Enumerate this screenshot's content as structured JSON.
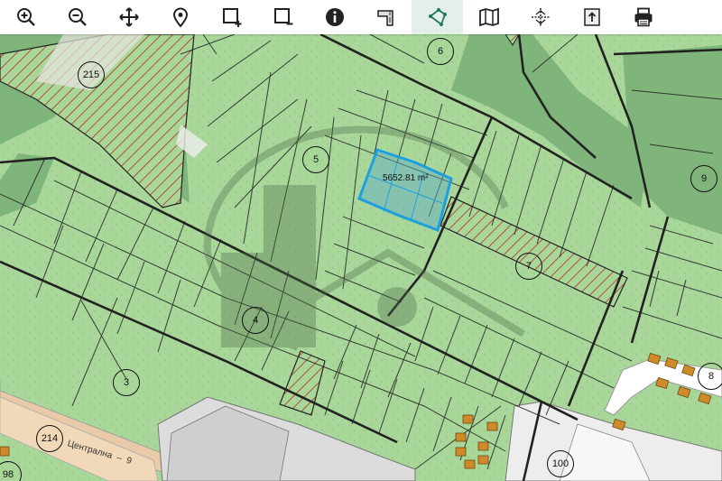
{
  "toolbar": {
    "tools": [
      {
        "name": "zoom-in",
        "icon": "zoom-in-icon"
      },
      {
        "name": "zoom-out",
        "icon": "zoom-out-icon"
      },
      {
        "name": "pan",
        "icon": "move-icon"
      },
      {
        "name": "locate",
        "icon": "map-pin-icon"
      },
      {
        "name": "select-add",
        "icon": "select-add-icon"
      },
      {
        "name": "select-remove",
        "icon": "select-remove-icon"
      },
      {
        "name": "info",
        "icon": "info-icon"
      },
      {
        "name": "measure-area",
        "icon": "measure-area-icon"
      },
      {
        "name": "polygon",
        "icon": "polygon-icon",
        "active": true
      },
      {
        "name": "layers",
        "icon": "map-icon"
      },
      {
        "name": "coordinates",
        "icon": "crosshair-icon"
      },
      {
        "name": "export",
        "icon": "export-icon"
      },
      {
        "name": "print",
        "icon": "printer-icon"
      }
    ]
  },
  "map": {
    "selected_area": "5652.81 m²",
    "road_name": "Централна",
    "road_number": "9",
    "parcel_numbers": [
      "215",
      "6",
      "5",
      "9",
      "7",
      "4",
      "3",
      "8",
      "214",
      "100",
      "98"
    ],
    "colors": {
      "parcel_fill": "#a9d79a",
      "forest_fill": "#7fb57b",
      "hatch": "#b03020",
      "selection": "#1ea0e0",
      "road": "#e8c9a8"
    }
  }
}
